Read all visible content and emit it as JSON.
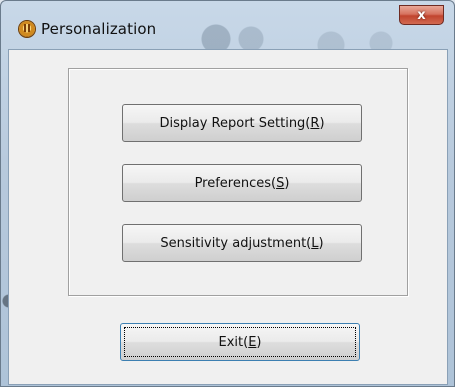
{
  "window": {
    "title": "Personalization",
    "close_label": "x",
    "icon": "app-icon"
  },
  "buttons": {
    "display_report": {
      "text": "Display Report Setting(",
      "mnemonic": "R",
      "suffix": ")"
    },
    "preferences": {
      "text": "Preferences(",
      "mnemonic": "S",
      "suffix": ")"
    },
    "sensitivity": {
      "text": "Sensitivity adjustment(",
      "mnemonic": "L",
      "suffix": ")"
    },
    "exit": {
      "text": "Exit(",
      "mnemonic": "E",
      "suffix": ")"
    }
  },
  "colors": {
    "client_bg": "#f0f0f0",
    "close_red": "#c1442e",
    "frame_blue": "#b7c9dc"
  }
}
